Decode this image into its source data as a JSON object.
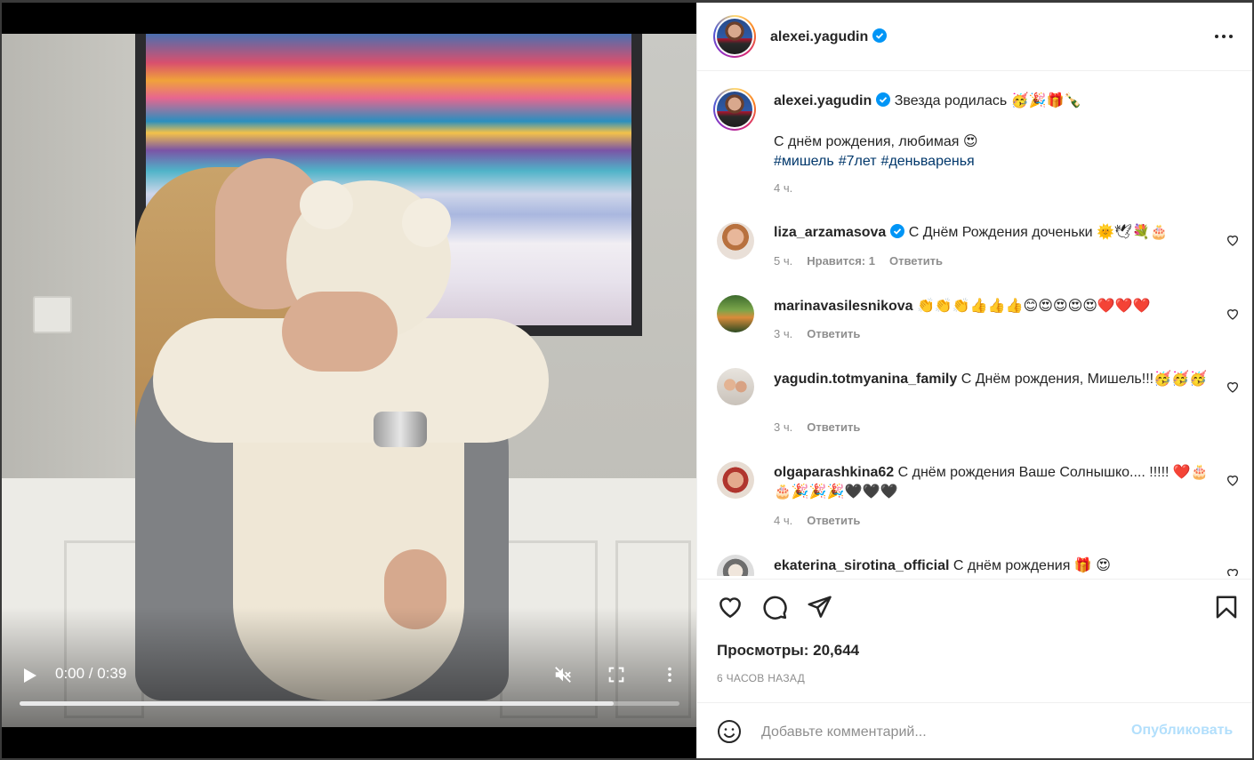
{
  "post": {
    "author": "alexei.yagudin",
    "more_icon": "more-horizontal-icon"
  },
  "video": {
    "time": "0:00 / 0:39",
    "progress": 0.9
  },
  "caption": {
    "username": "alexei.yagudin",
    "line1": "Звезда родилась 🥳🎉🎁🍾",
    "line2": "С днём рождения, любимая 😍",
    "hashtags": [
      "#мишель",
      "#7лет",
      "#деньваренья"
    ],
    "time": "4 ч."
  },
  "comments": [
    {
      "username": "liza_arzamasova",
      "verified": true,
      "text": "С Днём Рождения доченьки 🌞🕊💐🎂",
      "time": "5 ч.",
      "likes": "Нравится: 1",
      "reply": "Ответить"
    },
    {
      "username": "marinavasilesnikova",
      "verified": false,
      "text": "👏👏👏👍👍👍😊😍😍😍😍❤️❤️❤️",
      "time": "3 ч.",
      "likes": "",
      "reply": "Ответить"
    },
    {
      "username": "yagudin.totmyanina_family",
      "verified": false,
      "text": "С Днём рождения, Мишель!!!🥳🥳🥳",
      "time": "3 ч.",
      "likes": "",
      "reply": "Ответить"
    },
    {
      "username": "olgaparashkina62",
      "verified": false,
      "text": "С днём рождения Ваше Солнышко.... !!!!! ❤️🎂🎂🎉🎉🎉🖤🖤🖤",
      "time": "4 ч.",
      "likes": "",
      "reply": "Ответить"
    },
    {
      "username": "ekaterina_sirotina_official",
      "verified": false,
      "text": "С днём рождения 🎁 😍",
      "time": "",
      "likes": "",
      "reply": ""
    }
  ],
  "footer": {
    "views": "Просмотры: 20,644",
    "posted": "6 ЧАСОВ НАЗАД",
    "comment_placeholder": "Добавьте комментарий...",
    "publish": "Опубликовать"
  },
  "colors": {
    "link": "#00376b",
    "verified": "#0095f6",
    "publish_disabled": "#b2dffc",
    "muted": "#8e8e8e"
  }
}
